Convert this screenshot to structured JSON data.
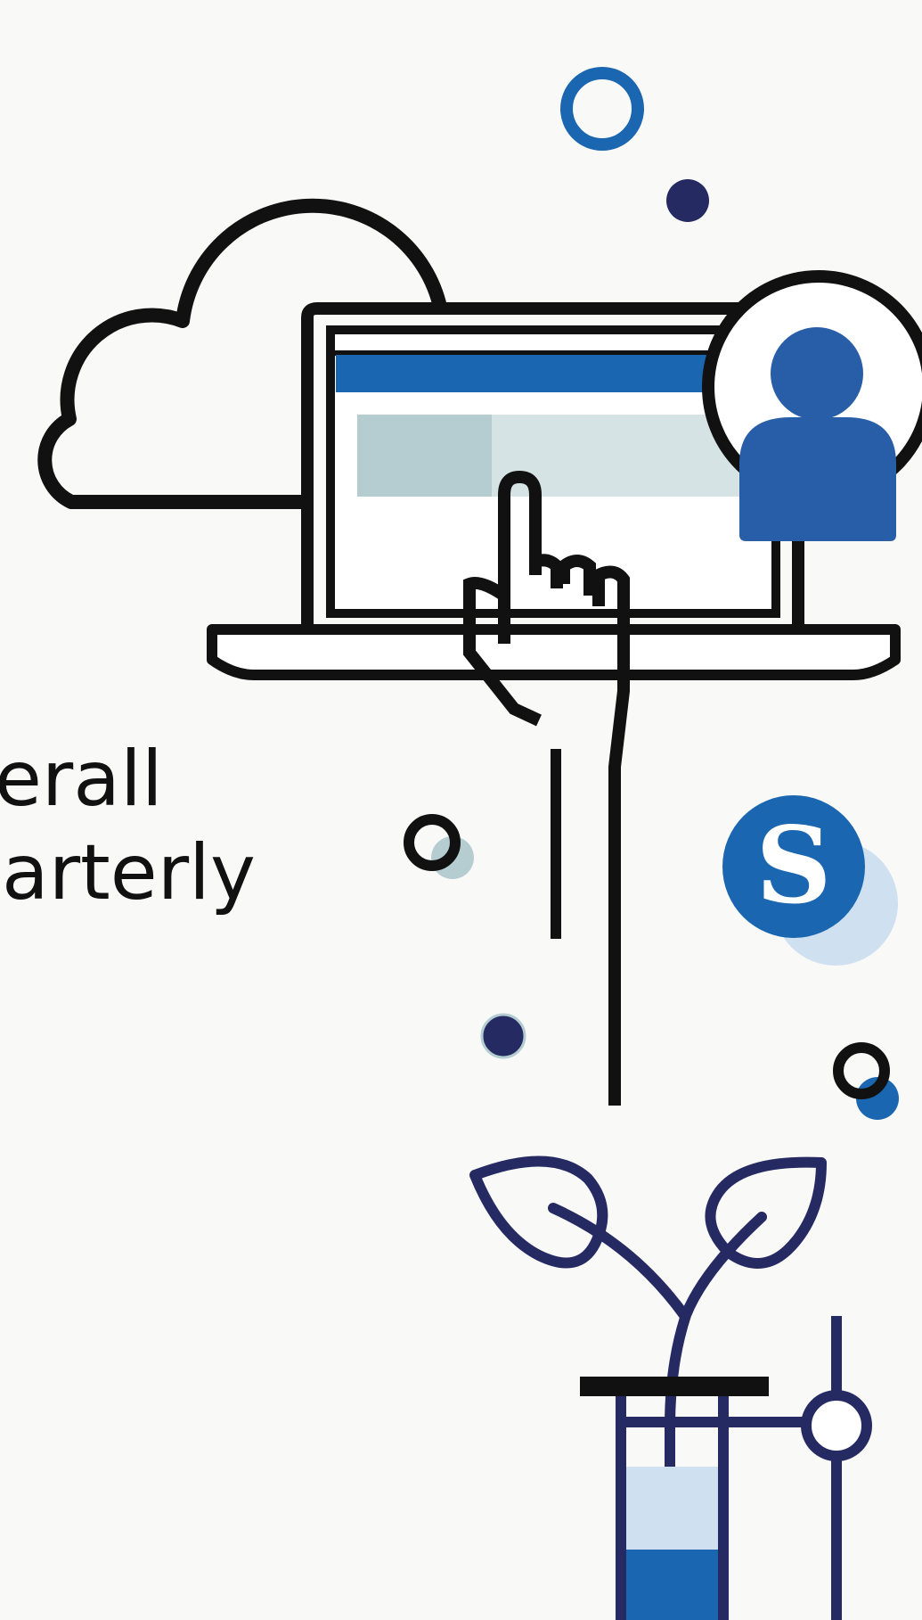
{
  "caption": {
    "line1": "erall",
    "line2": "arterly"
  },
  "logo": {
    "letter": "S"
  },
  "icons": [
    "cloud-icon",
    "laptop-icon",
    "pointing-hand-icon",
    "user-avatar-icon",
    "s-logo-icon",
    "sprout-icon",
    "test-tube-rack-icon"
  ],
  "colors": {
    "background": "#f9f9f8",
    "outline": "#111111",
    "primary_blue": "#1a66b0",
    "avatar_blue": "#285ea8",
    "navy": "#262a63",
    "light_blue": "#cfe0f1",
    "teal_gray": "#b5cdd1",
    "light_teal": "#d6e3e4"
  }
}
